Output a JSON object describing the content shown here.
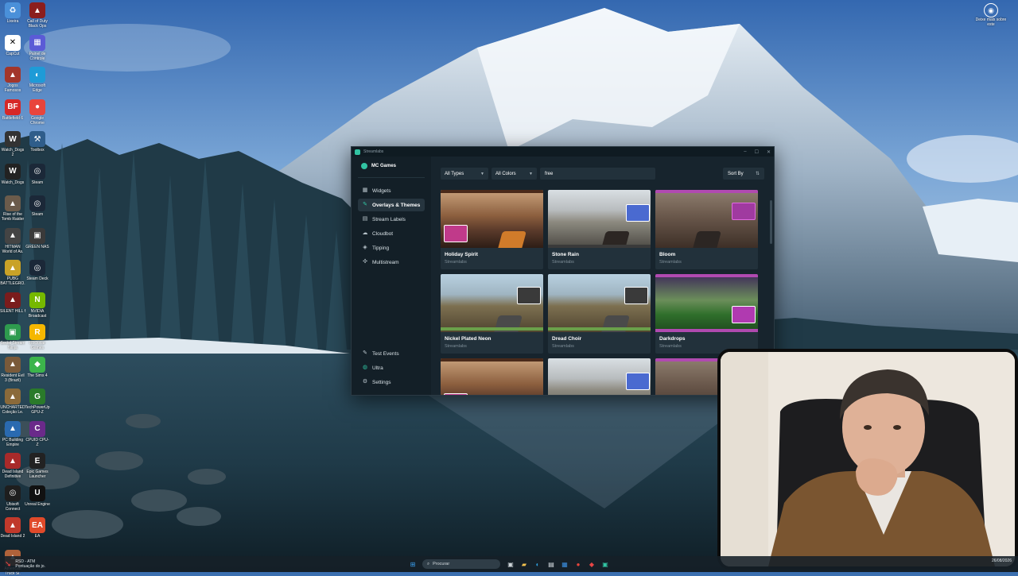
{
  "desktop": {
    "icons": [
      {
        "label": "Lixeira",
        "icon": "recycle-bin-icon",
        "color": "#4a90d9"
      },
      {
        "label": "Call of Duty Black Ops",
        "icon": "game-icon",
        "color": "#8b1e1e"
      },
      {
        "label": "CapCut",
        "icon": "capcut-icon",
        "color": "#ffffff"
      },
      {
        "label": "Painel de Controle",
        "icon": "control-panel-icon",
        "color": "#5b5bd6"
      },
      {
        "label": "Jogos Famosos",
        "icon": "game-icon",
        "color": "#a3362b"
      },
      {
        "label": "Microsoft Edge",
        "icon": "edge-icon",
        "color": "#1e9bd7"
      },
      {
        "label": "Battlefield 6",
        "icon": "bf-icon",
        "color": "#d62828"
      },
      {
        "label": "Google Chrome",
        "icon": "chrome-icon",
        "color": "#e8453c"
      },
      {
        "label": "Watch_Dogs 2",
        "icon": "watchdogs-icon",
        "color": "#333333"
      },
      {
        "label": "Toolbox",
        "icon": "tool-icon",
        "color": "#2f5d8a"
      },
      {
        "label": "Watch_Dogs",
        "icon": "watchdogs-icon",
        "color": "#222222"
      },
      {
        "label": "Steam",
        "icon": "steam-icon",
        "color": "#1b2838"
      },
      {
        "label": "Rise of the Tomb Raider",
        "icon": "game-icon",
        "color": "#6b5b4b"
      },
      {
        "label": "Steam",
        "icon": "steam-icon",
        "color": "#1b2838"
      },
      {
        "label": "HITMAN World of As.",
        "icon": "game-icon",
        "color": "#444444"
      },
      {
        "label": "GREEN NAS",
        "icon": "app-icon",
        "color": "#3a3a3a"
      },
      {
        "label": "PUBG BATTLEGRO.",
        "icon": "game-icon",
        "color": "#c9a227"
      },
      {
        "label": "Steam Deck",
        "icon": "steam-icon",
        "color": "#1b2838"
      },
      {
        "label": "SILENT HILL f",
        "icon": "game-icon",
        "color": "#7a1c1c"
      },
      {
        "label": "NVIDIA Broadcast",
        "icon": "nvidia-icon",
        "color": "#76b900"
      },
      {
        "label": "Social Stream Ninja",
        "icon": "app-icon",
        "color": "#2e9b4e"
      },
      {
        "label": "Rockstar Games",
        "icon": "rockstar-icon",
        "color": "#f5b700"
      },
      {
        "label": "Resident Evil 3 (Brazil)",
        "icon": "game-icon",
        "color": "#7a5a3a"
      },
      {
        "label": "The Sims 4",
        "icon": "sims-icon",
        "color": "#3cb44b"
      },
      {
        "label": "UNCHARTED Coleção Le.",
        "icon": "game-icon",
        "color": "#8a6a3a"
      },
      {
        "label": "TechPowerUp GPU-Z",
        "icon": "gpuz-icon",
        "color": "#2a7a2a"
      },
      {
        "label": "PC Building Empire",
        "icon": "game-icon",
        "color": "#2a6ab0"
      },
      {
        "label": "CPUID CPU-Z",
        "icon": "cpuz-icon",
        "color": "#6a2a8a"
      },
      {
        "label": "Dead Island Definitive",
        "icon": "game-icon",
        "color": "#a82a2a"
      },
      {
        "label": "Epic Games Launcher",
        "icon": "epic-icon",
        "color": "#222222"
      },
      {
        "label": "Ubisoft Connect",
        "icon": "ubisoft-icon",
        "color": "#1e1e1e"
      },
      {
        "label": "Unreal Engine",
        "icon": "unreal-icon",
        "color": "#111111"
      },
      {
        "label": "Dead Island 2",
        "icon": "game-icon",
        "color": "#c0392b"
      },
      {
        "label": "EA",
        "icon": "ea-icon",
        "color": "#e04a2a"
      },
      {
        "label": "American Truck Si.",
        "icon": "game-icon",
        "color": "#b0623a"
      }
    ],
    "top_right": {
      "label": "Deixe mais sobre este",
      "icon": "camera-icon"
    }
  },
  "streamlabs": {
    "window_title": "Streamlabs",
    "window_controls": [
      "–",
      "☐",
      "✕"
    ],
    "account": "MC Games",
    "nav": [
      {
        "label": "Widgets",
        "icon": "widgets-icon",
        "active": false
      },
      {
        "label": "Overlays & Themes",
        "icon": "overlays-icon",
        "active": true
      },
      {
        "label": "Stream Labels",
        "icon": "labels-icon",
        "active": false
      },
      {
        "label": "Cloudbot",
        "icon": "cloud-icon",
        "active": false
      },
      {
        "label": "Tipping",
        "icon": "tipping-icon",
        "active": false
      },
      {
        "label": "Multistream",
        "icon": "multistream-icon",
        "active": false
      }
    ],
    "nav_bottom": [
      {
        "label": "Test Events",
        "icon": "wrench-icon"
      },
      {
        "label": "Ultra",
        "icon": "ultra-icon"
      },
      {
        "label": "Settings",
        "icon": "gear-icon"
      }
    ],
    "filters": {
      "type_value": "All Types",
      "color_value": "All Colors",
      "search_value": "free",
      "sort_label": "Sort By"
    },
    "themes": [
      {
        "name": "Holiday Spirit",
        "author": "Streamlabs",
        "style": "ind"
      },
      {
        "name": "Stone Rain",
        "author": "Streamlabs",
        "style": "stone"
      },
      {
        "name": "Bloom",
        "author": "Streamlabs",
        "style": "bloom"
      },
      {
        "name": "Nickel Plated Neon",
        "author": "Streamlabs",
        "style": "fall"
      },
      {
        "name": "Dread Choir",
        "author": "Streamlabs",
        "style": "fall"
      },
      {
        "name": "Darkdrops",
        "author": "Streamlabs",
        "style": "rocket"
      },
      {
        "name": "",
        "author": "",
        "style": "ind"
      },
      {
        "name": "",
        "author": "",
        "style": "stone"
      },
      {
        "name": "",
        "author": "",
        "style": "bloom"
      }
    ],
    "accent": "#31c3a2"
  },
  "taskbar": {
    "left_title": "RSD - ATM",
    "left_subtitle": "Pontuação do jo.",
    "search_placeholder": "Procurar",
    "date": "26/08/2026"
  }
}
